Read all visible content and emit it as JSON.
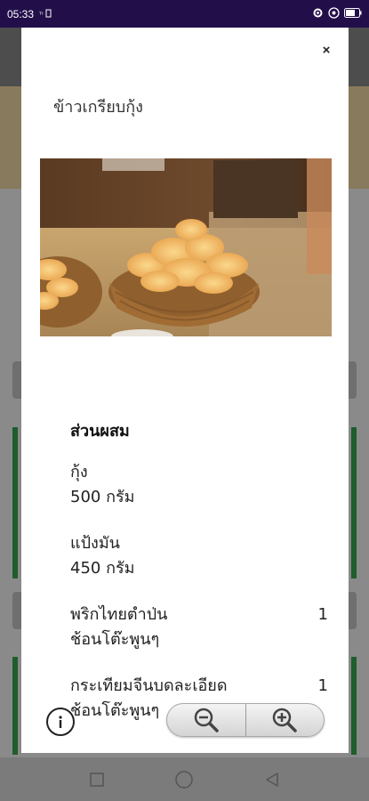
{
  "status_bar": {
    "time": "05:33",
    "icons": [
      "sim-icon",
      "gear-status-icon",
      "wifi-icon",
      "battery-icon"
    ]
  },
  "modal": {
    "title": "ข้าวเกรียบกุ้ง",
    "close_label": "×",
    "photo_icon": "shrimp-crackers-photo"
  },
  "ingredients": {
    "heading": "ส่วนผสม",
    "items": [
      {
        "name": "กุ้ง",
        "amount": "500 กรัม",
        "qty": ""
      },
      {
        "name": "แป้งมัน",
        "amount": "450 กรัม",
        "qty": ""
      },
      {
        "name": "พริกไทยตำป่น",
        "amount": "ช้อนโต๊ะพูนๆ",
        "qty": "1"
      },
      {
        "name": "กระเทียมจีนบดละเอียด",
        "amount": "ช้อนโต๊ะพูนๆ",
        "qty": "1"
      }
    ]
  },
  "controls": {
    "info_icon": "info-icon",
    "zoom_out_icon": "zoom-out-icon",
    "zoom_in_icon": "zoom-in-icon"
  },
  "nav": {
    "icons": [
      "recent-apps-icon",
      "home-icon",
      "back-icon"
    ]
  },
  "colors": {
    "status_bar": "#220f4a",
    "accent_green": "#1f5d2c",
    "modal_bg": "#ffffff"
  }
}
